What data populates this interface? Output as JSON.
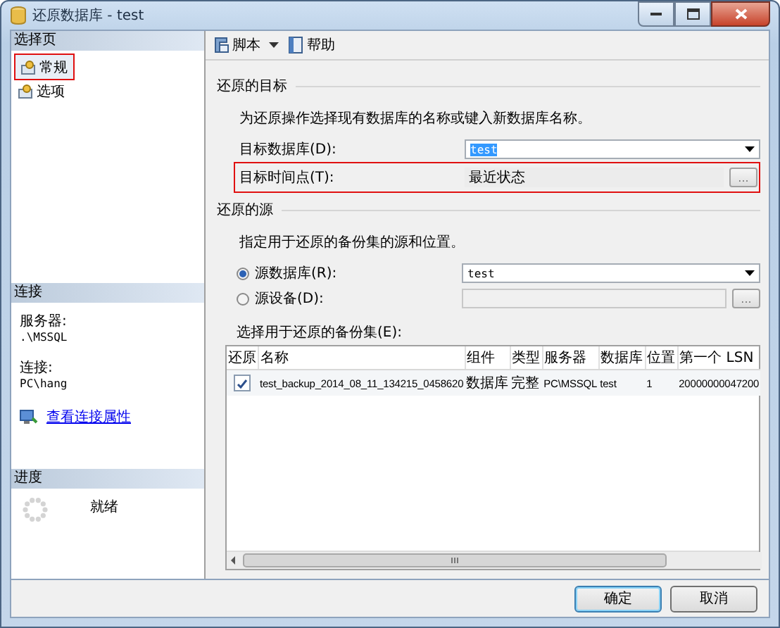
{
  "window": {
    "title": "还原数据库 - test"
  },
  "sidebar": {
    "header": "选择页",
    "pages": [
      {
        "label": "常规",
        "selected": true,
        "annotated": true
      },
      {
        "label": "选项",
        "selected": false,
        "annotated": false
      }
    ],
    "connection": {
      "header": "连接",
      "server_label": "服务器:",
      "server": ".\\MSSQL",
      "connection_label": "连接:",
      "connection": "PC\\hang",
      "link": "查看连接属性"
    },
    "progress": {
      "header": "进度",
      "status": "就绪"
    }
  },
  "toolbar": [
    {
      "label": "脚本",
      "kind": "dropdown"
    },
    {
      "label": "帮助",
      "kind": "button"
    }
  ],
  "destination": {
    "header": "还原的目标",
    "description": "为还原操作选择现有数据库的名称或键入新数据库名称。",
    "database_label": "目标数据库(D):",
    "database": "test",
    "database_text_selected": true,
    "time_label": "目标时间点(T):",
    "time": "最近状态",
    "time_annotated": true,
    "browse_label": "..."
  },
  "source": {
    "header": "还原的源",
    "description": "指定用于还原的备份集的源和位置。",
    "options": [
      {
        "label": "源数据库(R):",
        "selected": true,
        "kind": "combo",
        "value": "test"
      },
      {
        "label": "源设备(D):",
        "selected": false,
        "kind": "path",
        "disabled": true,
        "browse_label": "..."
      }
    ],
    "backup_sets_label": "选择用于还原的备份集(E):"
  },
  "table": {
    "columns": [
      "还原",
      "名称",
      "组件",
      "类型",
      "服务器",
      "数据库",
      "位置",
      "第一个 LSN"
    ],
    "rows": [
      {
        "cells": [
          {
            "kind": "checkbox",
            "checked": true
          },
          {
            "kind": "text",
            "text": "test_backup_2014_08_11_134215_0458620"
          },
          {
            "kind": "text",
            "text": "数据库"
          },
          {
            "kind": "text",
            "text": "完整"
          },
          {
            "kind": "text",
            "text": "PC\\MSSQL"
          },
          {
            "kind": "text",
            "text": "test"
          },
          {
            "kind": "text",
            "text": "1"
          },
          {
            "kind": "text",
            "text": "20000000047200"
          }
        ]
      }
    ]
  },
  "buttons": [
    {
      "label": "确定",
      "default": true
    },
    {
      "label": "取消",
      "default": false
    }
  ]
}
